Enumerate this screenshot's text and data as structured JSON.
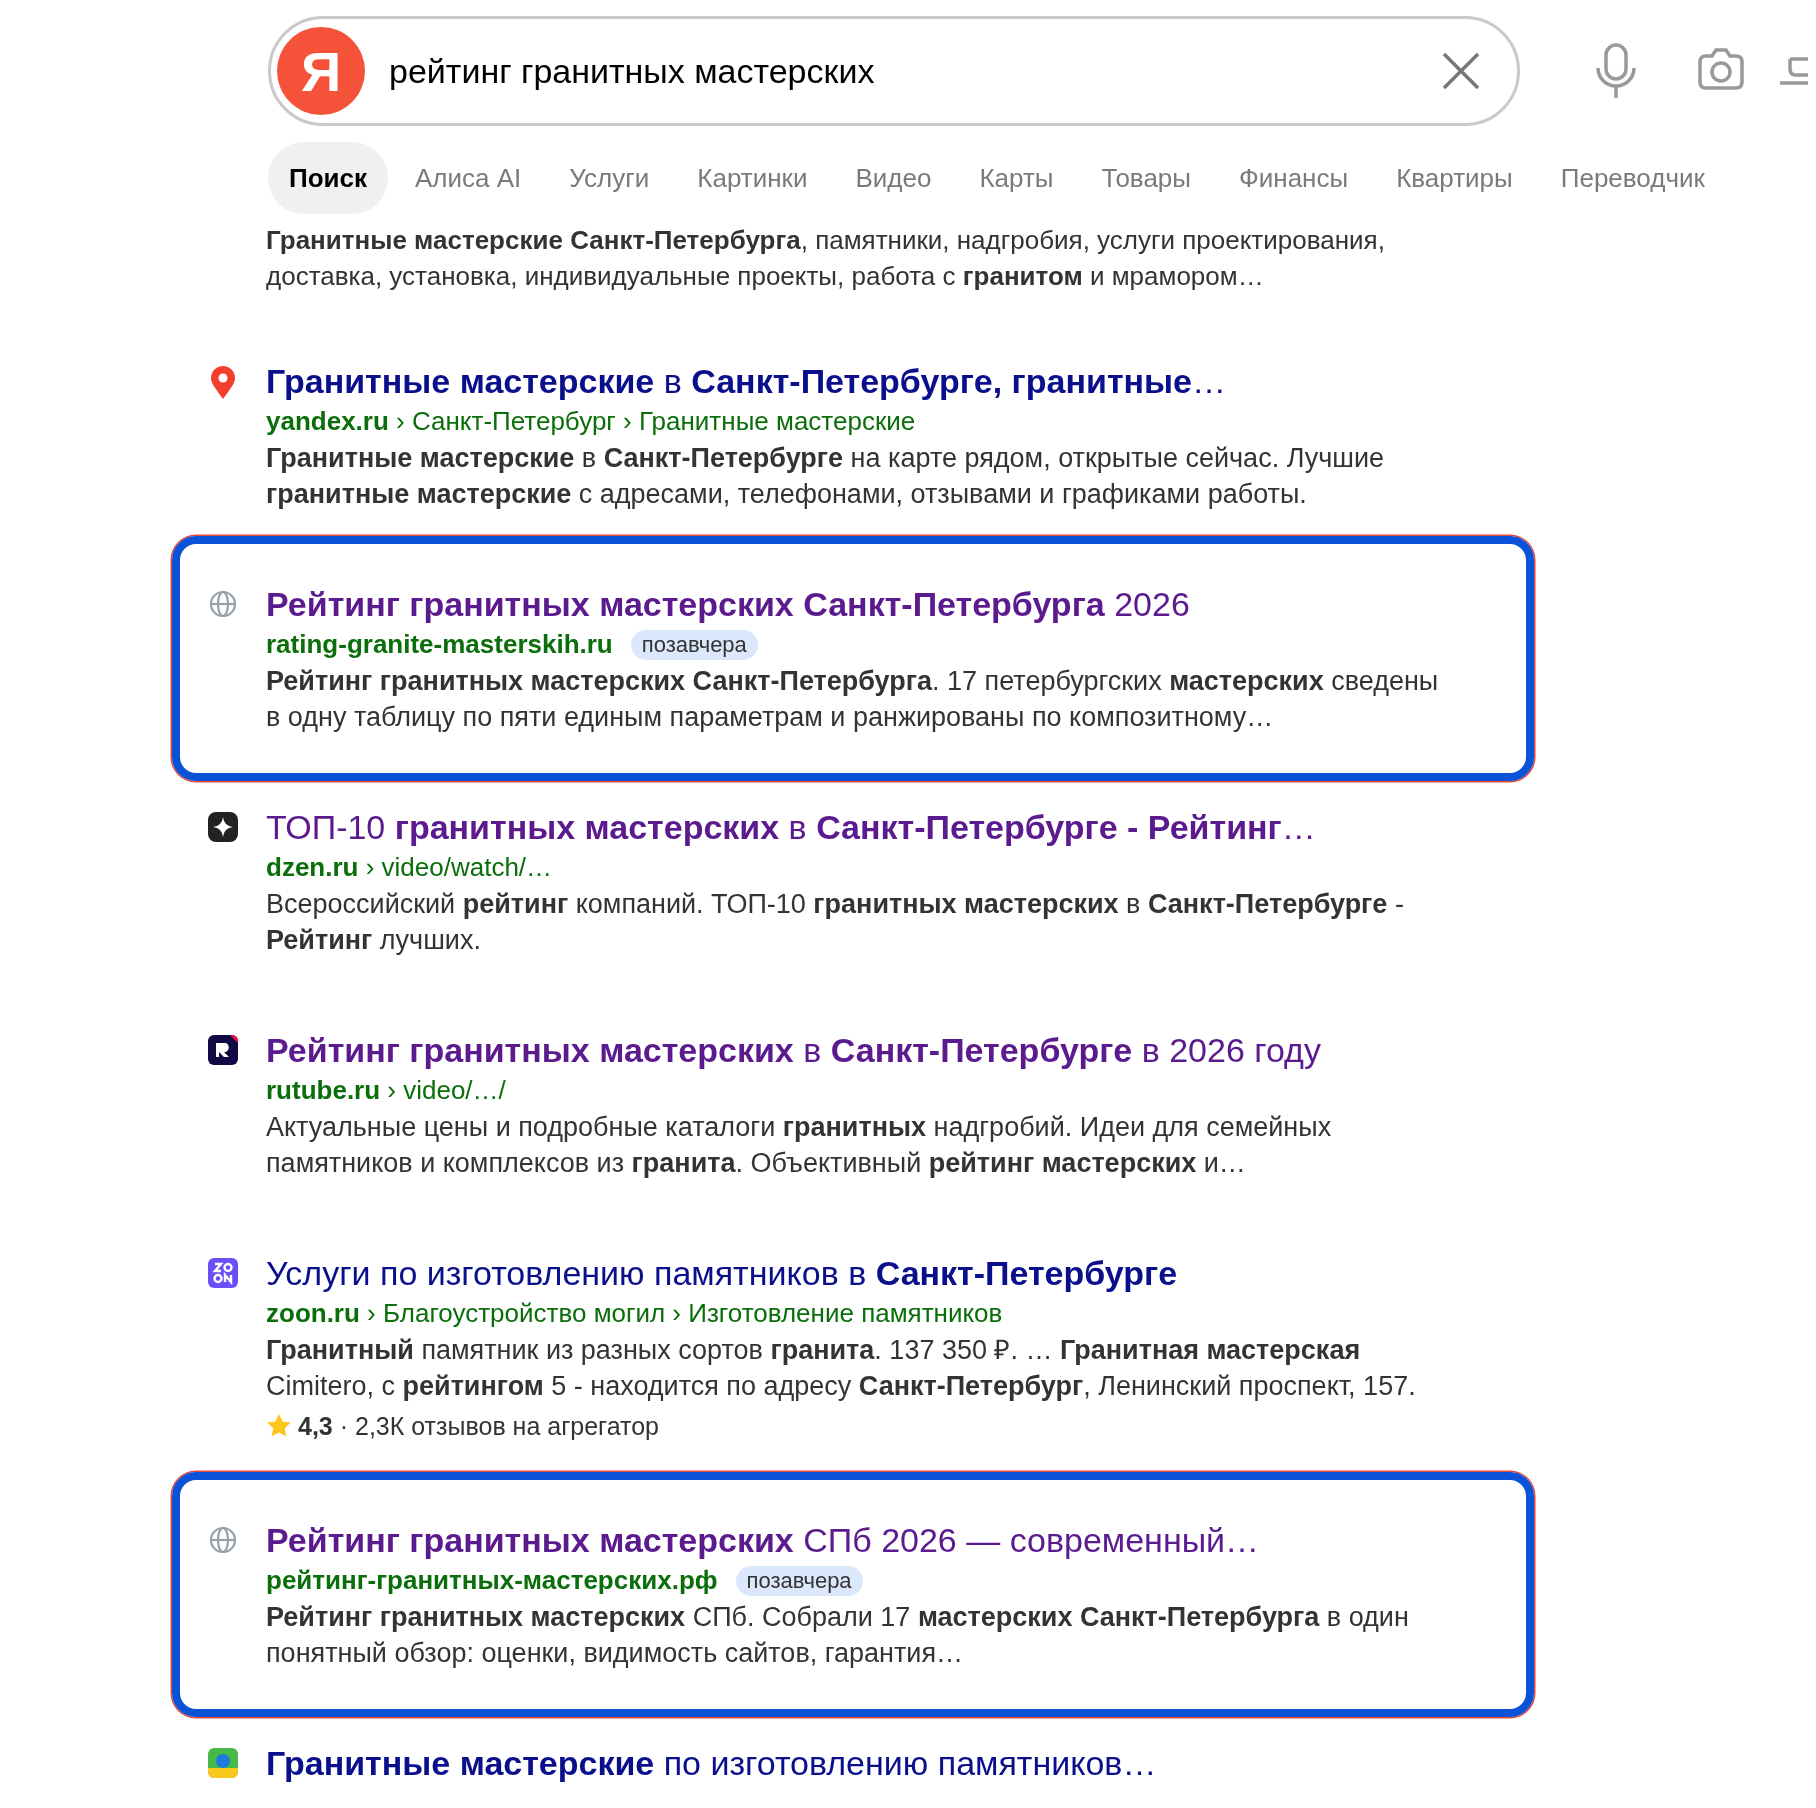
{
  "search": {
    "logo": "Я",
    "query": "рейтинг гранитных мастерских"
  },
  "tabs": [
    {
      "label": "Поиск",
      "selected": true
    },
    {
      "label": "Алиса AI",
      "selected": false
    },
    {
      "label": "Услуги",
      "selected": false
    },
    {
      "label": "Картинки",
      "selected": false
    },
    {
      "label": "Видео",
      "selected": false
    },
    {
      "label": "Карты",
      "selected": false
    },
    {
      "label": "Товары",
      "selected": false
    },
    {
      "label": "Финансы",
      "selected": false
    },
    {
      "label": "Квартиры",
      "selected": false
    },
    {
      "label": "Переводчик",
      "selected": false
    }
  ],
  "top_snippet": "**Гранитные мастерские Санкт-Петербурга**, памятники, надгробия, услуги проектирования, доставка, установка, индивидуальные проекты, работа с **гранитом** и мрамором…",
  "results": [
    {
      "kind": "pin",
      "highlighted": false,
      "visited": false,
      "title": "**Гранитные мастерские** в **Санкт-Петербурге, гранитные**…",
      "url": "**yandex.ru** › Санкт-Петербург › Гранитные мастерские",
      "snippet": "**Гранитные мастерские** в **Санкт-Петербурге** на карте рядом, открытые сейчас. Лучшие **гранитные мастерские** с адресами, телефонами, отзывами и графиками работы."
    },
    {
      "kind": "globe",
      "highlighted": true,
      "visited": true,
      "title": "**Рейтинг гранитных мастерских Санкт-Петербурга** 2026",
      "url": "**rating-granite-masterskih.ru**",
      "badge": "позавчера",
      "snippet": "**Рейтинг гранитных мастерских Санкт-Петербурга**. 17 петербургских **мастерских** сведены в одну таблицу по пяти единым параметрам и ранжированы по композитному…"
    },
    {
      "kind": "dzen",
      "highlighted": false,
      "visited": true,
      "title": "ТОП-10 **гранитных мастерских** в **Санкт-Петербурге - Рейтинг**…",
      "url": "**dzen.ru** › video/watch/…",
      "snippet": "Всероссийский **рейтинг** компаний. ТОП-10 **гранитных мастерских** в **Санкт-Петербурге** - **Рейтинг** лучших."
    },
    {
      "kind": "rutube",
      "highlighted": false,
      "visited": true,
      "title": "**Рейтинг гранитных мастерских** в **Санкт-Петербурге** в 2026 году",
      "url": "**rutube.ru** › video/…/",
      "snippet": "Актуальные цены и подробные каталоги **гранитных** надгробий. Идеи для семейных памятников и комплексов из **гранита**. Объективный **рейтинг мастерских** и…"
    },
    {
      "kind": "zoon",
      "highlighted": false,
      "visited": false,
      "title": "Услуги по изготовлению памятников в **Санкт-Петербурге**",
      "url": "**zoon.ru** › Благоустройство могил › Изготовление памятников",
      "snippet": "**Гранитный** памятник из разных сортов **гранита**. 137 350 ₽. … **Гранитная мастерская** Cimitero, с **рейтингом** 5 - находится по адресу **Санкт-Петербург**, Ленинский проспект, 157.",
      "rating": "**4,3** · 2,3К отзывов на агрегатор"
    },
    {
      "kind": "globe",
      "highlighted": true,
      "visited": true,
      "title": "**Рейтинг гранитных мастерских** СПб 2026 — современный…",
      "url": "**рейтинг-гранитных-мастерских.рф**",
      "badge": "позавчера",
      "snippet": "**Рейтинг гранитных мастерских** СПб. Собрали 17 **мастерских Санкт-Петербурга** в один понятный обзор: оценки, видимость сайтов, гарантия…"
    },
    {
      "kind": "map",
      "highlighted": false,
      "visited": false,
      "title": "**Гранитные мастерские** по изготовлению памятников…"
    }
  ]
}
